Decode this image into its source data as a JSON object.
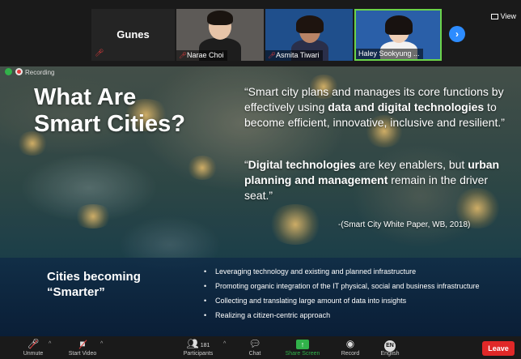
{
  "participants": [
    {
      "name": "Gunes",
      "muted": true
    },
    {
      "name": "Narae Choi",
      "muted": true
    },
    {
      "name": "Asmita Tiwari",
      "muted": true
    },
    {
      "name": "Haley Sookyung ...",
      "muted": false,
      "active_speaker": true
    }
  ],
  "view_label": "View",
  "recording_label": "Recording",
  "slide": {
    "title_line1": "What Are",
    "title_line2": "Smart Cities?",
    "quote1": {
      "p1": "“Smart city plans and manages its core functions by effectively using ",
      "b1": "data and digital technologies",
      "p2": " to become efficient, innovative, inclusive and resilient.”"
    },
    "quote2": {
      "p1": "“",
      "b1": "Digital technologies",
      "p2": " are key enablers, but ",
      "b2": "urban planning and management",
      "p3": " remain in the driver seat.”"
    },
    "citation": "-(Smart City White Paper, WB, 2018)",
    "lower_title_line1": "Cities becoming",
    "lower_title_line2": "“Smarter”",
    "bullets": [
      "Leveraging technology and existing and planned infrastructure",
      "Promoting organic integration of the IT physical, social and business infrastructure",
      "Collecting and translating large amount of data into insights",
      "Realizing a citizen-centric approach"
    ]
  },
  "toolbar": {
    "unmute": "Unmute",
    "start_video": "Start Video",
    "participants_count": "181",
    "participants": "Participants",
    "chat": "Chat",
    "share_screen": "Share Screen",
    "record": "Record",
    "english_badge": "EN",
    "english": "English",
    "leave": "Leave"
  },
  "colors": {
    "leave": "#e02828",
    "share": "#31b24a",
    "active_speaker_border": "#6bd34a",
    "next_button": "#2d8cff"
  }
}
